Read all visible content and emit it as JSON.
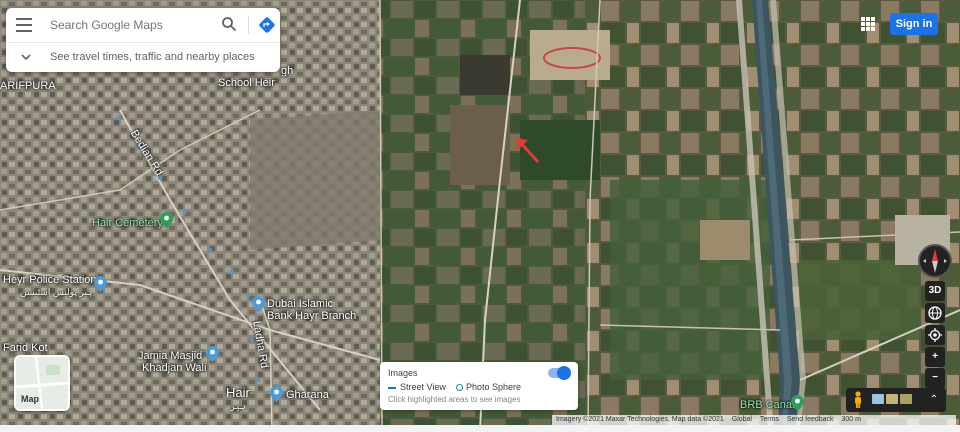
{
  "search": {
    "placeholder": "Search Google Maps",
    "hint": "See travel times, traffic and nearby places"
  },
  "header": {
    "sign_in": "Sign in"
  },
  "places": {
    "arifpura": "ARIFPURA",
    "school": "School Heir",
    "school_frag": "gh",
    "bedian_rd": "Bedian Rd",
    "cemetery": "Hair Cemetery",
    "police": "Heyr Police Station",
    "police_sub": "ہیر پولیس اسٹیشن",
    "dubai_bank": "Dubai Islamic",
    "dubai_bank2": "Bank Hayr Branch",
    "ladha_rd": "Ladha Rd",
    "farid_kot": "Farid Kot",
    "jamia": "Jamia Masjid",
    "jamia2": "Khadjan Wali",
    "hair": "Hair",
    "hair_sub": "ہیر",
    "gharana": "Gharana",
    "brb": "BRB Canal"
  },
  "controls": {
    "three_d": "3D",
    "zoom_in": "+",
    "zoom_out": "−",
    "expand": "⌃"
  },
  "map_type": {
    "label": "Map"
  },
  "images_panel": {
    "title": "Images",
    "street_view": "Street View",
    "photo_sphere": "Photo Sphere",
    "hint": "Click highlighted areas to see images",
    "toggle_on": true
  },
  "attribution": {
    "imagery": "Imagery ©2021 Maxar Technologies, Map data ©2021",
    "global": "Global",
    "terms": "Terms",
    "feedback": "Send feedback",
    "scale": "300 m"
  },
  "colors": {
    "accent": "#1a73e8",
    "pin": "#4a9bd8",
    "green_pin": "#2e9e5a",
    "arrow": "#e53935"
  }
}
